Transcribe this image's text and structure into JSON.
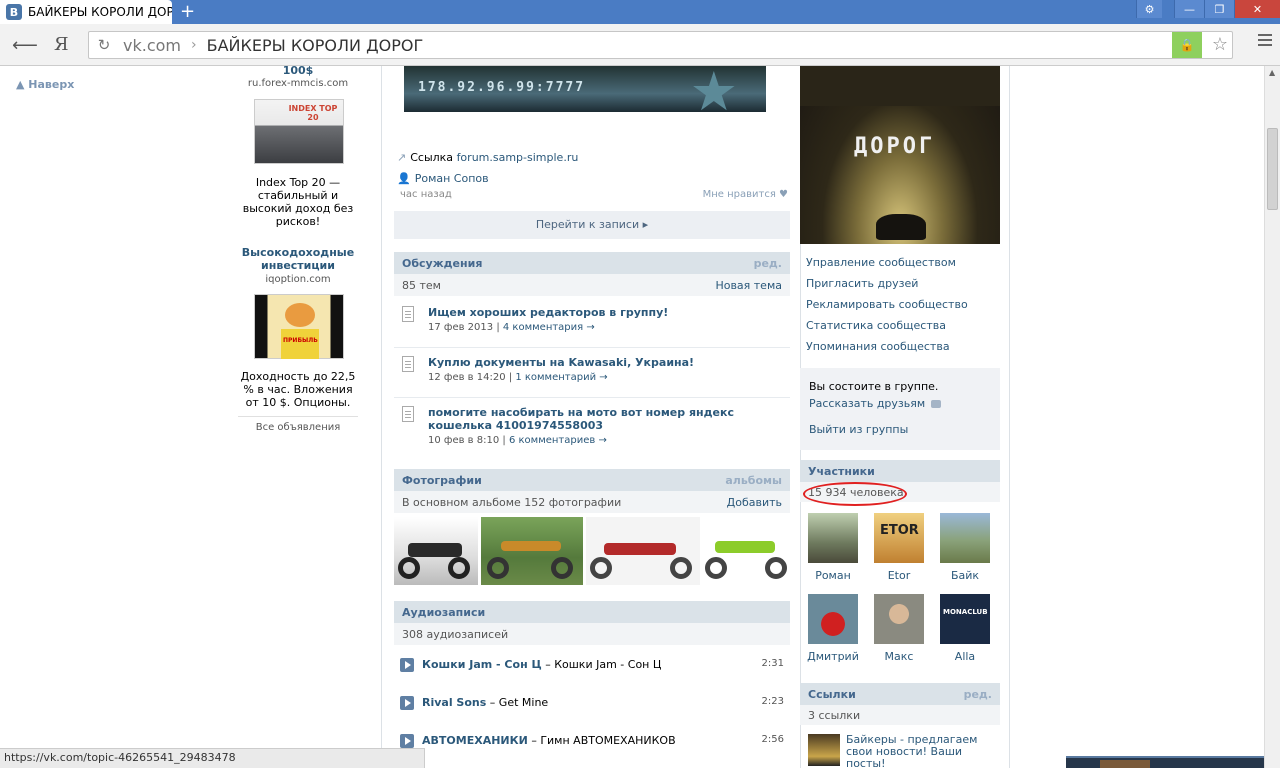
{
  "browser": {
    "tab_title": "БАЙКЕРЫ КОРОЛИ ДОРОГ",
    "tab_favicon": "В",
    "new_tab": "+",
    "address_domain": "vk.com",
    "address_sep": "›",
    "address_title": "БАЙКЕРЫ КОРОЛИ ДОРОГ",
    "yandex_btn": "Я",
    "status_url": "https://vk.com/topic-46265541_29483478"
  },
  "left": {
    "go_top": "Наверх"
  },
  "ads": {
    "ad1_price": "100$",
    "ad1_src": "ru.forex-mmcis.com",
    "ad1_img_text": "INDEX TOP 20",
    "ad1_text": "Index Top 20 — стабильный и высокий доход без рисков!",
    "ad2_title": "Высокодоходные инвестиции",
    "ad2_src": "iqoption.com",
    "ad2_img_text": "ПРИБЫЛЬ",
    "ad2_text": "Доходность до 22,5 % в час. Вложения от 10 $. Опционы.",
    "all": "Все объявления"
  },
  "post": {
    "banner_text": "178.92.96.99:7777",
    "link_prefix": "Ссылка",
    "link_url": "forum.samp-simple.ru",
    "author": "Роман Сопов",
    "time": "час назад",
    "like": "Мне нравится",
    "goto": "Перейти к записи"
  },
  "discussions": {
    "title": "Обсуждения",
    "edit": "ред.",
    "count": "85 тем",
    "new_topic": "Новая тема",
    "topics": [
      {
        "title": "Ищем хороших редакторов в группу!",
        "date": "17 фев 2013",
        "comments": "4 комментария →"
      },
      {
        "title": "Куплю документы на Kawasaki, Украина!",
        "date": "12 фев в 14:20",
        "comments": "1 комментарий →"
      },
      {
        "title": "помогите насобирать на мото вот номер яндекс кошелька 41001974558003",
        "date": "10 фев в 8:10",
        "comments": "6 комментариев →"
      }
    ]
  },
  "photos": {
    "title": "Фотографии",
    "albums": "альбомы",
    "sub": "В основном альбоме 152 фотографии",
    "add": "Добавить"
  },
  "audio": {
    "title": "Аудиозаписи",
    "count": "308 аудиозаписей",
    "tracks": [
      {
        "artist": "Кошки Jam - Сон Ц",
        "title": "Кошки Jam - Сон Ц",
        "duration": "2:31"
      },
      {
        "artist": "Rival Sons",
        "title": "Get Mine",
        "duration": "2:23"
      },
      {
        "artist": "АВТОМЕХАНИКИ",
        "title": "Гимн АВТОМЕХАНИКОВ",
        "duration": "2:56"
      }
    ]
  },
  "group": {
    "avatar_text": "ДОРОГ",
    "actions": [
      "Управление сообществом",
      "Пригласить друзей",
      "Рекламировать сообщество",
      "Статистика сообщества",
      "Упоминания сообщества"
    ],
    "member_status": "Вы состоите в группе.",
    "tell_friends": "Рассказать друзьям",
    "leave": "Выйти из группы"
  },
  "members": {
    "title": "Участники",
    "count": "15 934 человека",
    "list": [
      {
        "name": "Роман"
      },
      {
        "name": "Etor",
        "img_text": "ETOR"
      },
      {
        "name": "Байк"
      },
      {
        "name": "Дмитрий"
      },
      {
        "name": "Макс"
      },
      {
        "name": "Alla",
        "img_text": "MONACLUB"
      }
    ]
  },
  "links": {
    "title": "Ссылки",
    "edit": "ред.",
    "count": "3 ссылки",
    "item1": "Байкеры - предлагаем свои новости! Ваши посты!"
  }
}
